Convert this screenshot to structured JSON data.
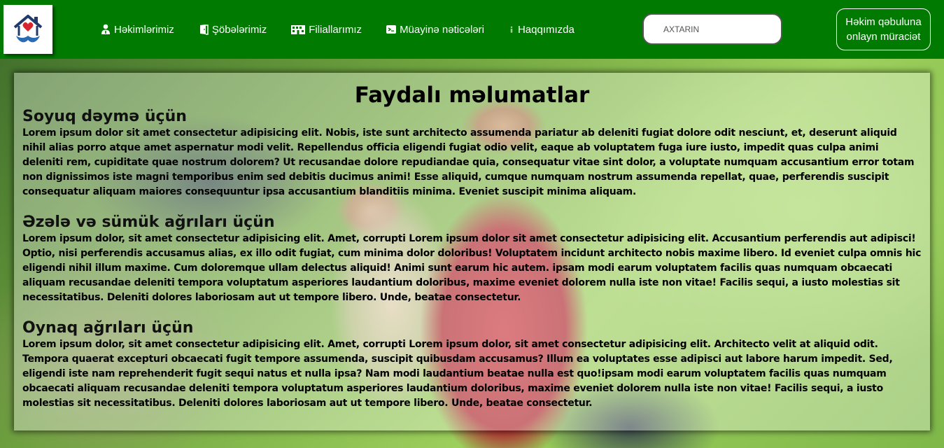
{
  "header": {
    "logo": {
      "icon": "heart-house-hands-icon",
      "colors": {
        "house": "#1f3a6b",
        "heart": "#d7262e",
        "hands": "#2a6bb3"
      }
    },
    "nav": [
      {
        "label": "Həkimlərimiz",
        "icon": "doctor-icon"
      },
      {
        "label": "Şöbələrimiz",
        "icon": "door-icon"
      },
      {
        "label": "Filiallarımız",
        "icon": "building-icon"
      },
      {
        "label": "Müayinə nəticələri",
        "icon": "document-icon"
      },
      {
        "label": "Haqqımızda",
        "icon": "info-icon"
      }
    ],
    "search": {
      "placeholder": "AXTARIN",
      "value": ""
    },
    "appointment_button": "Həkim qəbuluna onlayn müraciət",
    "bg_color": "#007a00"
  },
  "main": {
    "title": "Faydalı məlumatlar",
    "sections": [
      {
        "title": "Soyuq dəymə üçün",
        "text": "Lorem ipsum dolor sit amet consectetur adipisicing elit. Nobis, iste sunt architecto assumenda pariatur ab deleniti fugiat dolore odit nesciunt, et, deserunt aliquid nihil alias porro atque amet aspernatur modi velit. Repellendus officia eligendi fugiat odio velit, eaque ab voluptatem fuga iure iusto, impedit quas culpa animi deleniti rem, cupiditate quae nostrum dolorem? Ut recusandae dolore repudiandae quia, consequatur vitae sint dolor, a voluptate numquam accusantium error totam non dignissimos iste magni temporibus enim sed debitis ducimus animi! Esse aliquid, cumque numquam nostrum assumenda repellat, quae, perferendis suscipit consequatur aliquam maiores consequuntur ipsa accusantium blanditiis minima. Eveniet suscipit minima aliquam."
      },
      {
        "title": "Əzələ və sümük ağrıları üçün",
        "text": "Lorem ipsum dolor, sit amet consectetur adipisicing elit. Amet, corrupti Lorem ipsum dolor sit amet consectetur adipisicing elit. Accusantium perferendis aut adipisci! Optio, nisi perferendis accusamus alias, ex illo odit fugiat, cum minima dolor doloribus! Voluptatem incidunt architecto nobis maxime libero. Id eveniet culpa omnis hic eligendi nihil illum maxime. Cum doloremque ullam delectus aliquid! Animi sunt earum hic autem. ipsam modi earum voluptatem facilis quas numquam obcaecati aliquam recusandae deleniti tempora voluptatum asperiores laudantium doloribus, maxime eveniet dolorem nulla iste non vitae! Facilis sequi, a iusto molestias sit necessitatibus. Deleniti dolores laboriosam aut ut tempore libero. Unde, beatae consectetur."
      },
      {
        "title": "Oynaq ağrıları üçün",
        "text": "Lorem ipsum dolor, sit amet consectetur adipisicing elit. Amet, corrupti Lorem ipsum dolor, sit amet consectetur adipisicing elit. Architecto velit at aliquid odit. Tempora quaerat excepturi obcaecati fugit tempore assumenda, suscipit quibusdam accusamus? Illum ea voluptates esse adipisci aut labore harum impedit. Sed, eligendi iste nam reprehenderit fugit sequi natus et nulla ipsa? Nam modi laudantium beatae nulla est quo!ipsam modi earum voluptatem facilis quas numquam obcaecati aliquam recusandae deleniti tempora voluptatum asperiores laudantium doloribus, maxime eveniet dolorem nulla iste non vitae! Facilis sequi, a iusto molestias sit necessitatibus. Deleniti dolores laboriosam aut ut tempore libero. Unde, beatae consectetur."
      }
    ]
  }
}
